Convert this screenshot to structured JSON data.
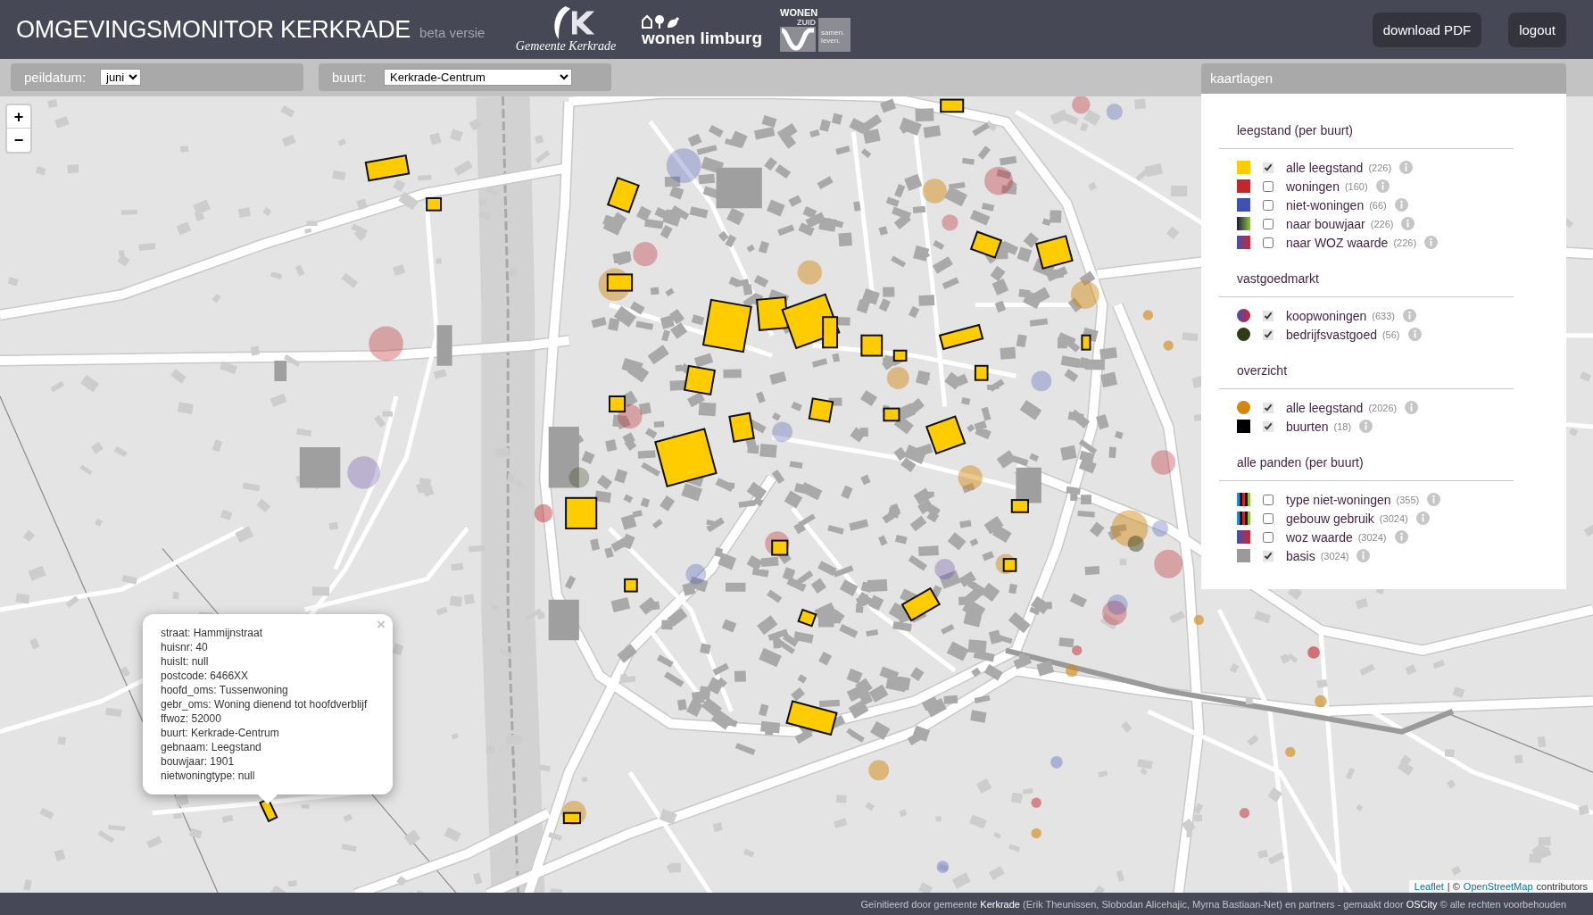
{
  "header": {
    "title": "OMGEVINGSMONITOR KERKRADE",
    "subtitle": "beta versie",
    "logos": [
      {
        "kind": "municipality",
        "text": "Gemeente Kerkrade"
      },
      {
        "kind": "figures",
        "text": "wonen limburg"
      },
      {
        "kind": "wave",
        "text": "WONEN",
        "subtext": "ZUID",
        "tagline": "samen. leven."
      }
    ],
    "buttons": [
      "download PDF",
      "logout"
    ]
  },
  "filters": [
    {
      "label": "peildatum:",
      "value": "juni"
    },
    {
      "label": "buurt:",
      "value": "Kerkrade-Centrum"
    }
  ],
  "map": {
    "zoom_controls": [
      "+",
      "−"
    ],
    "popup": {
      "close": "×",
      "lines": [
        "straat: Hammijnstraat",
        "huisnr: 40",
        "huislt: null",
        "postcode: 6466XX",
        "hoofd_oms: Tussenwoning",
        "gebr_oms: Woning dienend tot hoofdverblijf",
        "ffwoz: 52000",
        "buurt: Kerkrade-Centrum",
        "gebnaam: Leegstand",
        "bouwjaar: 1901",
        "nietwoningtype: null"
      ]
    },
    "attribution": [
      {
        "kind": "link",
        "text": "Leaflet"
      },
      {
        "kind": "text",
        "text": "| ©"
      },
      {
        "kind": "link",
        "text": "OpenStreetMap"
      },
      {
        "kind": "text",
        "text": "contributors"
      }
    ]
  },
  "layer_panel": {
    "title": "kaartlagen",
    "sections": [
      {
        "title": "leegstand (per buurt)",
        "items": [
          {
            "kind": "square",
            "color": "#ffcc00",
            "checked": true,
            "label": "alle leegstand",
            "count": "(226)"
          },
          {
            "kind": "square",
            "color": "#c1272d",
            "checked": false,
            "label": "woningen",
            "count": "(160)"
          },
          {
            "kind": "square",
            "color": "#3f51b5",
            "checked": false,
            "label": "niet-woningen",
            "count": "(66)"
          },
          {
            "kind": "age-gradient",
            "checked": false,
            "label": "naar bouwjaar",
            "count": "(226)"
          },
          {
            "kind": "value-gradient",
            "checked": false,
            "label": "naar WOZ waarde",
            "count": "(226)"
          }
        ]
      },
      {
        "title": "vastgoedmarkt",
        "items": [
          {
            "kind": "value-gradient-circle",
            "checked": true,
            "label": "koopwoningen",
            "count": "(633)"
          },
          {
            "kind": "circle",
            "color": "#2f3a16",
            "checked": true,
            "label": "bedrijfsvastgoed",
            "count": "(56)"
          }
        ]
      },
      {
        "title": "overzicht",
        "items": [
          {
            "kind": "circle",
            "color": "#d4860b",
            "checked": true,
            "label": "alle leegstand",
            "count": "(2026)"
          },
          {
            "kind": "square",
            "color": "#000000",
            "checked": true,
            "label": "buurten",
            "count": "(18)"
          }
        ]
      },
      {
        "title": "alle panden (per buurt)",
        "items": [
          {
            "kind": "stripes",
            "checked": false,
            "label": "type niet-woningen",
            "count": "(355)"
          },
          {
            "kind": "stripes",
            "checked": false,
            "label": "gebouw gebruik",
            "count": "(3024)"
          },
          {
            "kind": "value-gradient",
            "checked": false,
            "label": "woz waarde",
            "count": "(3024)"
          },
          {
            "kind": "square",
            "color": "#999999",
            "checked": true,
            "label": "basis",
            "count": "(3024)"
          }
        ]
      }
    ]
  },
  "footer": {
    "text": "Geïnitieerd door gemeente **Kerkrade** (Erik Theunissen, Slobodan Alicehajic, Myrna Bastiaan-Net) en partners - gemaakt door **OSCity** © alle rechten voorbehouden"
  }
}
